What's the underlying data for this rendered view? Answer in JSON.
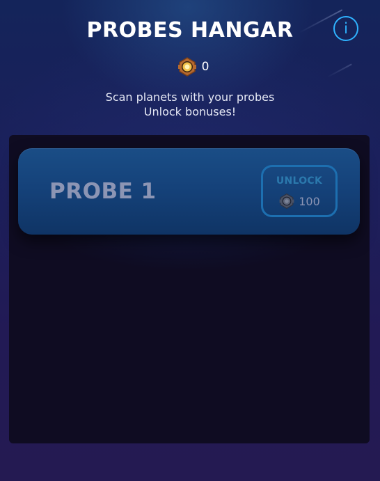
{
  "header": {
    "title": "PROBES HANGAR",
    "info_icon": "info-icon",
    "info_label": "i"
  },
  "currency": {
    "icon": "probe-chip-icon",
    "count": "0"
  },
  "subtitle": {
    "line1": "Scan planets with your probes",
    "line2": "Unlock bonuses!"
  },
  "probes": [
    {
      "name": "PROBE 1",
      "unlock_label": "UNLOCK",
      "cost_icon": "probe-chip-icon-locked",
      "cost": "100"
    }
  ],
  "colors": {
    "accent_blue": "#2fb3ff",
    "card_blue": "#15427a",
    "panel_dark": "#0f0c22",
    "chip_gold": "#f2c14a",
    "chip_bronze": "#c8763a"
  }
}
